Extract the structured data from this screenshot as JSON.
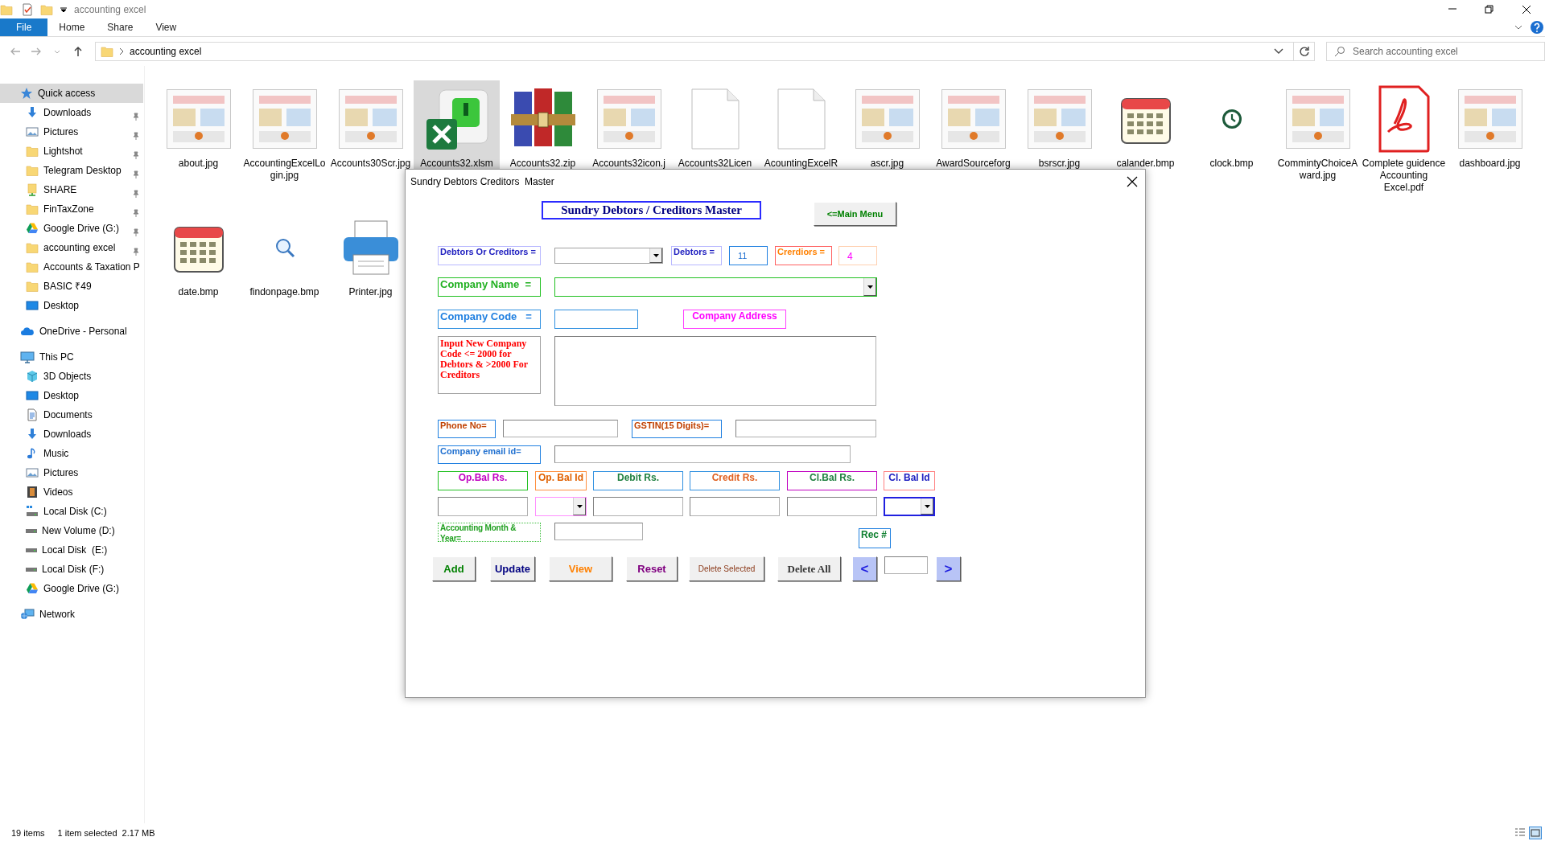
{
  "window": {
    "title": "accounting excel"
  },
  "ribbon_tabs": [
    {
      "label": "File",
      "selected": true
    },
    {
      "label": "Home",
      "selected": false
    },
    {
      "label": "Share",
      "selected": false
    },
    {
      "label": "View",
      "selected": false
    }
  ],
  "address": {
    "path": "accounting excel"
  },
  "search": {
    "placeholder": "Search accounting excel"
  },
  "navigation": [
    {
      "label": "Quick access",
      "kind": "star",
      "selected": true,
      "children": [
        {
          "label": "Downloads",
          "kind": "download",
          "pinned": true,
          "selected": false
        },
        {
          "label": "Pictures",
          "kind": "pictures",
          "pinned": true,
          "selected": false
        },
        {
          "label": "Lightshot",
          "kind": "folder",
          "pinned": true,
          "selected": false
        },
        {
          "label": "Telegram Desktop",
          "kind": "folder",
          "pinned": true,
          "selected": false
        },
        {
          "label": "SHARE",
          "kind": "share",
          "pinned": true,
          "selected": false
        },
        {
          "label": "FinTaxZone",
          "kind": "folder",
          "pinned": true,
          "selected": false
        },
        {
          "label": "Google Drive (G:)",
          "kind": "gdrive",
          "pinned": true,
          "selected": false
        },
        {
          "label": "accounting excel",
          "kind": "folder",
          "pinned": true,
          "selected": false
        },
        {
          "label": "Accounts & Taxation P",
          "kind": "folder",
          "pinned": false,
          "selected": false
        },
        {
          "label": "BASIC ₹49",
          "kind": "folder",
          "pinned": false,
          "selected": false
        },
        {
          "label": "Desktop",
          "kind": "desktop",
          "pinned": false,
          "selected": false
        }
      ]
    },
    {
      "label": "OneDrive - Personal",
      "kind": "cloud",
      "selected": false
    },
    {
      "label": "This PC",
      "kind": "pc",
      "selected": false,
      "children": [
        {
          "label": "3D Objects",
          "kind": "cube",
          "selected": false
        },
        {
          "label": "Desktop",
          "kind": "desktop",
          "selected": false
        },
        {
          "label": "Documents",
          "kind": "docs",
          "selected": false
        },
        {
          "label": "Downloads",
          "kind": "download",
          "selected": false
        },
        {
          "label": "Music",
          "kind": "music",
          "selected": false
        },
        {
          "label": "Pictures",
          "kind": "pictures",
          "selected": false
        },
        {
          "label": "Videos",
          "kind": "videos",
          "selected": false
        },
        {
          "label": "Local Disk (C:)",
          "kind": "sysdisk",
          "selected": false
        },
        {
          "label": "New Volume (D:)",
          "kind": "disk",
          "selected": false
        },
        {
          "label": "Local Disk  (E:)",
          "kind": "disk",
          "selected": false
        },
        {
          "label": "Local Disk (F:)",
          "kind": "disk",
          "selected": false
        },
        {
          "label": "Google Drive (G:)",
          "kind": "gdrive",
          "selected": false
        }
      ]
    },
    {
      "label": "Network",
      "kind": "network",
      "selected": false
    }
  ],
  "files": [
    {
      "name": "about.jpg",
      "kind": "image",
      "selected": false
    },
    {
      "name": "AccountingExcelLogin.jpg",
      "kind": "image",
      "selected": false
    },
    {
      "name": "Accounts30Scr.jpg",
      "kind": "image",
      "selected": false
    },
    {
      "name": "Accounts32.xlsm",
      "kind": "excel",
      "selected": true
    },
    {
      "name": "Accounts32.zip",
      "kind": "archive",
      "selected": false
    },
    {
      "name": "Accounts32icon.j",
      "kind": "image",
      "selected": false
    },
    {
      "name": "Accounts32Licen",
      "kind": "document",
      "selected": false
    },
    {
      "name": "AcountingExcelR",
      "kind": "document",
      "selected": false
    },
    {
      "name": "ascr.jpg",
      "kind": "image",
      "selected": false
    },
    {
      "name": "AwardSourceforg",
      "kind": "image",
      "selected": false
    },
    {
      "name": "bsrscr.jpg",
      "kind": "image",
      "selected": false
    },
    {
      "name": "calander.bmp",
      "kind": "calendar",
      "selected": false
    },
    {
      "name": "clock.bmp",
      "kind": "clock",
      "selected": false
    },
    {
      "name": "CommintyChoiceAward.jpg",
      "kind": "image",
      "selected": false
    },
    {
      "name": "Complete guidence Accounting Excel.pdf",
      "kind": "pdf",
      "selected": false
    },
    {
      "name": "dashboard.jpg",
      "kind": "image",
      "selected": false
    },
    {
      "name": "date.bmp",
      "kind": "calendar",
      "selected": false
    },
    {
      "name": "findonpage.bmp",
      "kind": "magnifier",
      "selected": false
    },
    {
      "name": "Printer.jpg",
      "kind": "printer",
      "selected": false
    }
  ],
  "dialog": {
    "title": "Sundry Debtors Creditors  Master",
    "heading": "Sundry Debtors / Creditors Master",
    "main_menu_button": "<=Main Menu",
    "type_field": {
      "label": "Debtors Or Creditors ="
    },
    "debtors": {
      "label": "Debtors =",
      "value": "11"
    },
    "creditors": {
      "label": "Crerdiors =",
      "value": "4"
    },
    "company_name": {
      "label": "Company Name  ="
    },
    "company_code": {
      "label": "Company Code   ="
    },
    "company_address": {
      "label": "Company Address"
    },
    "code_hint": "Input New Company Code <= 2000 for Debtors & >2000 For Creditors",
    "phone": {
      "label": "Phone No="
    },
    "gstin": {
      "label": "GSTIN(15 Digits)="
    },
    "email": {
      "label": "Company email id="
    },
    "balance_columns": [
      {
        "label": "Op.Bal Rs.",
        "kind": "text"
      },
      {
        "label": "Op. Bal Id",
        "kind": "dropdown"
      },
      {
        "label": "Debit Rs.",
        "kind": "text"
      },
      {
        "label": "Credit Rs.",
        "kind": "text"
      },
      {
        "label": "Cl.Bal Rs.",
        "kind": "text"
      },
      {
        "label": "Cl. Bal Id",
        "kind": "dropdown"
      }
    ],
    "accounting_month": {
      "label": "Accounting Month & Year="
    },
    "record": {
      "label": "Rec #"
    },
    "buttons": [
      {
        "label": "Add"
      },
      {
        "label": "Update"
      },
      {
        "label": "View"
      },
      {
        "label": "Reset"
      },
      {
        "label": "Delete Selected"
      },
      {
        "label": "Delete All"
      }
    ],
    "previous_button": "<",
    "next_button": ">"
  },
  "status_bar": {
    "item_count": "19 items",
    "selection": "1 item selected",
    "size": "2.17 MB"
  }
}
